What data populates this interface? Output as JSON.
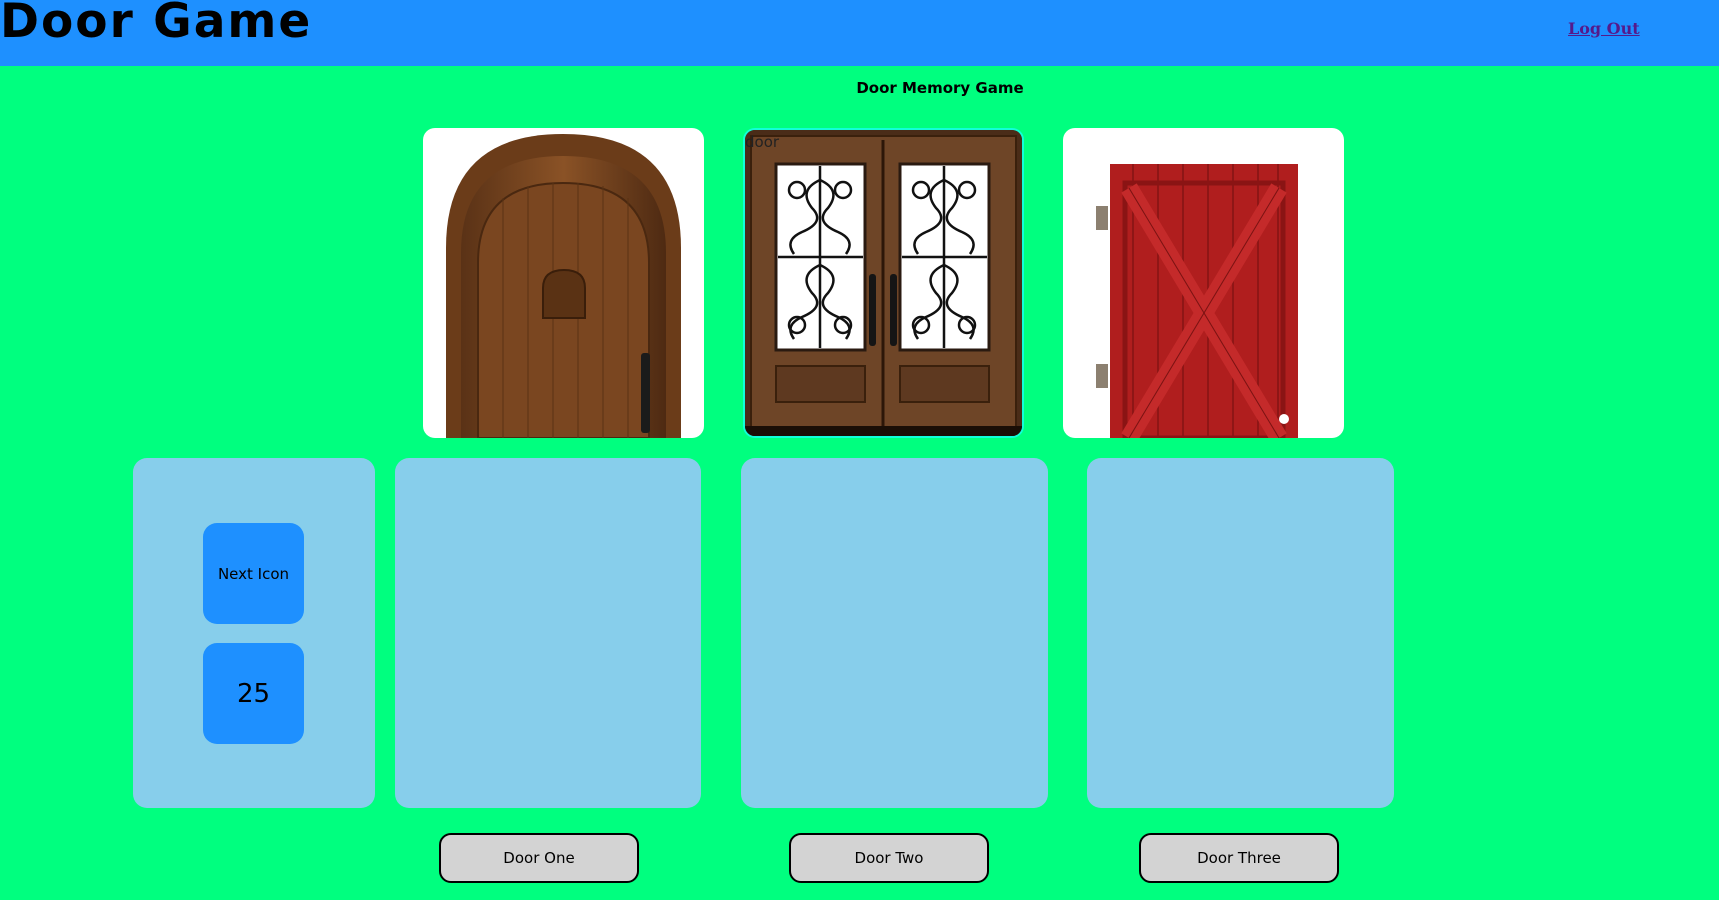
{
  "header": {
    "title": "Door Game",
    "logout_label": "Log Out"
  },
  "main": {
    "subtitle": "Door Memory Game",
    "doors": [
      {
        "image_icon": "arched-wooden-door-icon"
      },
      {
        "image_icon": "double-wrought-iron-door-icon",
        "caption": "door"
      },
      {
        "image_icon": "red-barn-door-icon"
      }
    ],
    "controls": {
      "next_label": "Next Icon",
      "counter": "25"
    },
    "door_buttons": [
      "Door One",
      "Door Two",
      "Door Three"
    ]
  },
  "colors": {
    "background": "#00ff7f",
    "header": "#1e90ff",
    "panel": "#87ceeb",
    "button_blue": "#1e90ff",
    "door_button": "#d3d3d3"
  }
}
